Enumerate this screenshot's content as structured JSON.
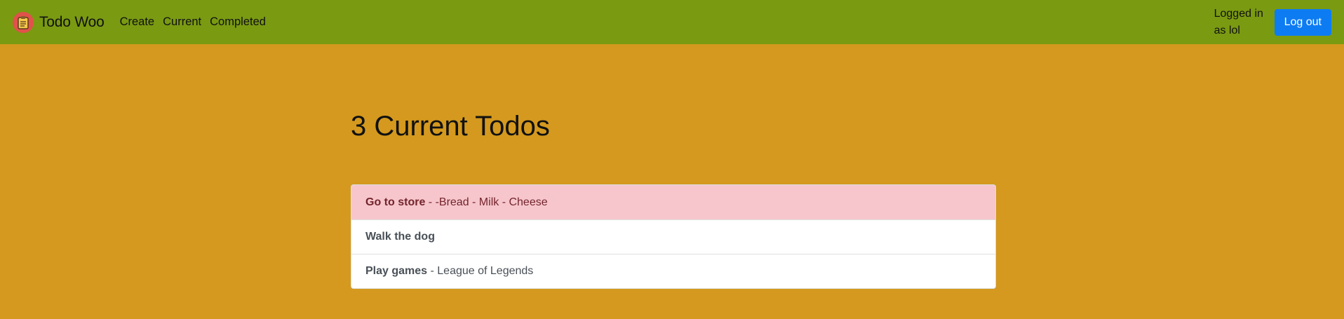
{
  "nav": {
    "brand": "Todo Woo",
    "links": [
      "Create",
      "Current",
      "Completed"
    ],
    "logged_in": "Logged in as lol",
    "logout": "Log out"
  },
  "main": {
    "title": "3 Current Todos",
    "todos": [
      {
        "title": "Go to store",
        "memo": " - -Bread - Milk - Cheese",
        "important": true
      },
      {
        "title": "Walk the dog",
        "memo": "",
        "important": false
      },
      {
        "title": "Play games",
        "memo": " - League of Legends",
        "important": false
      }
    ]
  },
  "colors": {
    "navbar": "#7a9a12",
    "background": "#d4991e",
    "logout_button": "#0d7cf3",
    "important_item": "#f6c6cc",
    "logo": "#e0524a"
  }
}
